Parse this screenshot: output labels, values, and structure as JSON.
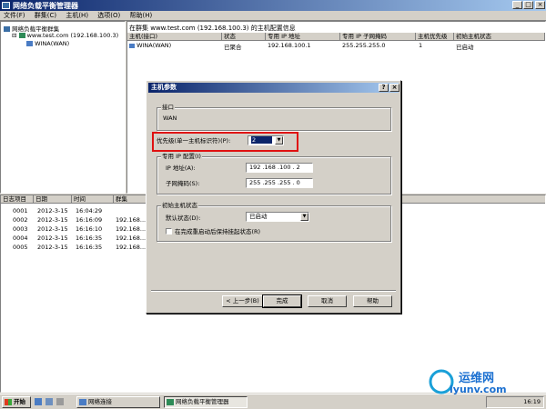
{
  "window": {
    "title": "网络负载平衡管理器",
    "min_glyph": "_",
    "max_glyph": "□",
    "close_glyph": "×"
  },
  "menu": [
    "文件(F)",
    "群集(C)",
    "主机(H)",
    "选项(O)",
    "帮助(H)"
  ],
  "tree": {
    "root": "网络负载平衡群集",
    "cluster": "www.test.com (192.168.100.3)",
    "host": "WINA(WAN)",
    "expander": "⊟"
  },
  "hosts_panel": {
    "caption": "在群集 www.test.com (192.168.100.3) 的主机配置信息",
    "columns": [
      "主机(接口)",
      "状态",
      "专用 IP 地址",
      "专用 IP 子网掩码",
      "主机优先级",
      "初始主机状态"
    ],
    "rows": [
      [
        "WINA(WAN)",
        "已聚合",
        "192.168.100.1",
        "255.255.255.0",
        "1",
        "已启动"
      ]
    ]
  },
  "log_panel": {
    "columns": [
      "日志项目",
      "日期",
      "时间",
      "群集"
    ],
    "rows": [
      [
        "0001",
        "2012-3-15",
        "16:04:29",
        ""
      ],
      [
        "0002",
        "2012-3-15",
        "16:16:09",
        "192.168..."
      ],
      [
        "0003",
        "2012-3-15",
        "16:16:10",
        "192.168..."
      ],
      [
        "0004",
        "2012-3-15",
        "16:16:35",
        "192.168..."
      ],
      [
        "0005",
        "2012-3-15",
        "16:16:35",
        "192.168..."
      ]
    ]
  },
  "dialog": {
    "title": "主机参数",
    "help_glyph": "?",
    "close_glyph": "×",
    "interface_group": "接口",
    "interface_value": "WAN",
    "priority_label": "优先级(单一主机标识符)(P):",
    "priority_value": "2",
    "dedicated_ip_group": "专用 IP 配置(I)",
    "ip_label": "IP 地址(A):",
    "ip_value": "192 .168 .100 . 2",
    "mask_label": "子网掩码(S):",
    "mask_value": "255 .255 .255 . 0",
    "initial_state_group": "初始主机状态",
    "default_state_label": "默认状态(D):",
    "default_state_value": "已启动",
    "persist_label": "在完成重启动后保持挂起状态(R)",
    "buttons": {
      "back": "< 上一步(B)",
      "finish": "完成",
      "cancel": "取消",
      "help": "帮助"
    },
    "combo_arrow": "▼"
  },
  "taskbar": {
    "start": "开始",
    "items": [
      "网络连接",
      "网络负载平衡管理器"
    ],
    "time": "16:19"
  },
  "watermark": {
    "brand": "运维网",
    "url": "iyunv.com"
  }
}
